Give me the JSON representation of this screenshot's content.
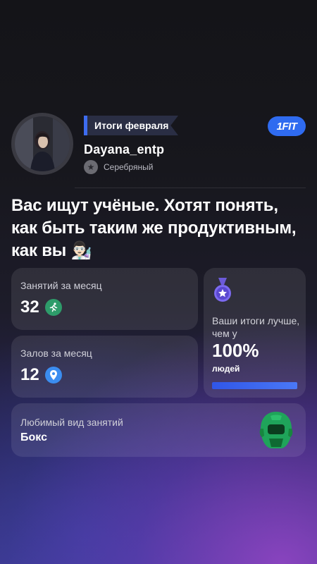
{
  "header": {
    "month_label": "Итоги февраля",
    "username": "Dayana_entp",
    "rank": "Серебряный",
    "rank_icon": "star-icon",
    "logo": "1FIT"
  },
  "headline": "Вас ищут учёные. Хотят понять, как быть таким же продуктивным, как вы 👨🏻‍🔬",
  "stats": {
    "sessions": {
      "title": "Занятий за месяц",
      "value": "32",
      "icon": "running-icon",
      "icon_color": "#2e9c6a"
    },
    "gyms": {
      "title": "Залов за месяц",
      "value": "12",
      "icon": "map-pin-icon",
      "icon_color": "#3b8df0"
    }
  },
  "results": {
    "badge_icon": "star-badge-icon",
    "text": "Ваши итоги лучше, чем у",
    "percent": "100%",
    "people": "людей",
    "progress": 1.0
  },
  "favorite": {
    "title": "Любимый вид занятий",
    "value": "Бокс",
    "icon": "boxing-helmet-icon",
    "icon_color": "#1fa45a"
  },
  "colors": {
    "accent": "#2f6bf0",
    "card_bg": "rgba(255,255,255,0.09)"
  }
}
